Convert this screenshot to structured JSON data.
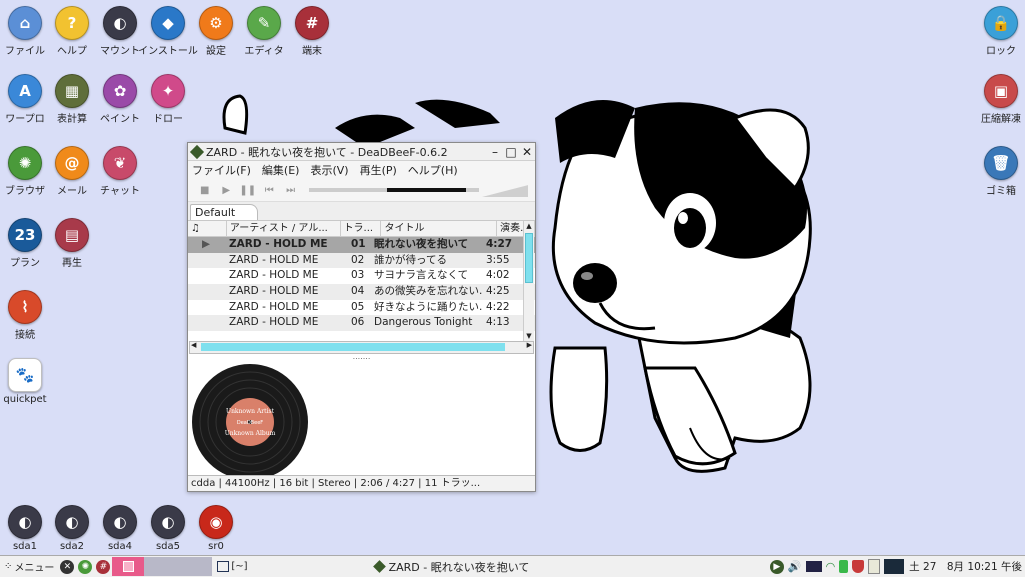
{
  "desktop": {
    "icons": [
      {
        "label": "ファイル",
        "color": "#5b8fd6",
        "glyph": "⌂"
      },
      {
        "label": "ヘルプ",
        "color": "#f2c230",
        "glyph": "?"
      },
      {
        "label": "マウント",
        "color": "#3a3a48",
        "glyph": "◐"
      },
      {
        "label": "インストール",
        "color": "#2a78c8",
        "glyph": "◆"
      },
      {
        "label": "設定",
        "color": "#f07a1a",
        "glyph": "⚙"
      },
      {
        "label": "エディタ",
        "color": "#5aa84a",
        "glyph": "✎"
      },
      {
        "label": "端末",
        "color": "#a8303a",
        "glyph": "#"
      },
      {
        "label": "ワープロ",
        "color": "#3a88d8",
        "glyph": "A"
      },
      {
        "label": "表計算",
        "color": "#5f6e3a",
        "glyph": "▦"
      },
      {
        "label": "ペイント",
        "color": "#9a4aa8",
        "glyph": "✿"
      },
      {
        "label": "ドロー",
        "color": "#d04a8a",
        "glyph": "✦"
      },
      {
        "label": "ブラウザ",
        "color": "#4a9a3a",
        "glyph": "✺"
      },
      {
        "label": "メール",
        "color": "#f08a1a",
        "glyph": "@"
      },
      {
        "label": "チャット",
        "color": "#c84a6a",
        "glyph": "❦"
      },
      {
        "label": "プラン",
        "color": "#1a5a9a",
        "glyph": "23"
      },
      {
        "label": "再生",
        "color": "#a83a4a",
        "glyph": "▤"
      },
      {
        "label": "接続",
        "color": "#d84a2a",
        "glyph": "⌇"
      },
      {
        "label": "quickpet",
        "color": "#ffffff",
        "glyph": "🐾"
      },
      {
        "label": "sda1",
        "color": "#3a3a48",
        "glyph": "◐"
      },
      {
        "label": "sda2",
        "color": "#3a3a48",
        "glyph": "◐"
      },
      {
        "label": "sda4",
        "color": "#3a3a48",
        "glyph": "◐"
      },
      {
        "label": "sda5",
        "color": "#3a3a48",
        "glyph": "◐"
      },
      {
        "label": "sr0",
        "color": "#c8281a",
        "glyph": "◉"
      },
      {
        "label": "ロック",
        "color": "#3aa0d8",
        "glyph": "🔒"
      },
      {
        "label": "圧縮解凍",
        "color": "#c84a4a",
        "glyph": "▣"
      },
      {
        "label": "ゴミ箱",
        "color": "#3a78b8",
        "glyph": "🗑"
      }
    ]
  },
  "window": {
    "title": "ZARD - 眠れない夜を抱いて - DeaDBeeF-0.6.2",
    "menu": [
      "ファイル(F)",
      "編集(E)",
      "表示(V)",
      "再生(P)",
      "ヘルプ(H)"
    ],
    "tab": "Default",
    "columns": [
      "♫",
      "アーティスト / アル...",
      "トラ...",
      "タイトル",
      "演奏..."
    ],
    "rows": [
      {
        "artist": "ZARD - HOLD ME",
        "track": "01",
        "title": "眠れない夜を抱いて",
        "length": "4:27",
        "playing": true
      },
      {
        "artist": "ZARD - HOLD ME",
        "track": "02",
        "title": "誰かが待ってる",
        "length": "3:55"
      },
      {
        "artist": "ZARD - HOLD ME",
        "track": "03",
        "title": "サヨナラ言えなくて",
        "length": "4:02"
      },
      {
        "artist": "ZARD - HOLD ME",
        "track": "04",
        "title": "あの微笑みを忘れない...",
        "length": "4:25"
      },
      {
        "artist": "ZARD - HOLD ME",
        "track": "05",
        "title": "好きなように踊りたい...",
        "length": "4:22"
      },
      {
        "artist": "ZARD - HOLD ME",
        "track": "06",
        "title": "Dangerous Tonight",
        "length": "4:13"
      }
    ],
    "progress": 0.47,
    "volume": 0.85,
    "album_art": {
      "artist_text": "Unknown Artist",
      "album_text": "Unknown Album",
      "logo": "DeaDBeeF"
    },
    "status": "cdda | 44100Hz | 16 bit | Stereo | 2:06 / 4:27 | 11 トラッ..."
  },
  "taskbar": {
    "menu_label": "メニュー",
    "terminal_task": "[~]",
    "active_task": "ZARD - 眠れない夜を抱いて",
    "clock": "土 27　8月 10:21 午後"
  }
}
